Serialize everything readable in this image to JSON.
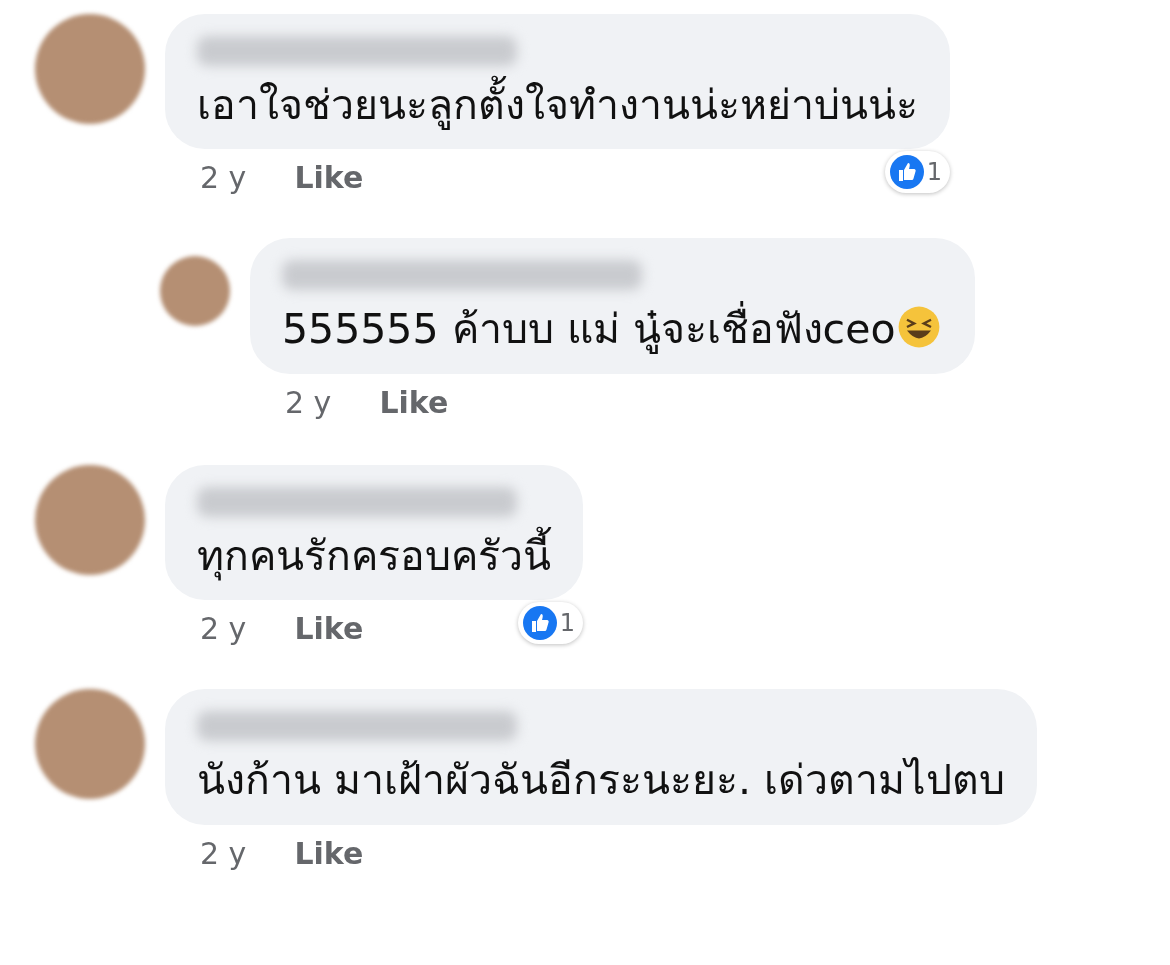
{
  "comments": [
    {
      "text": "เอาใจช่วยนะลูกตั้งใจทำงานน่ะหย่าบ่นน่ะ",
      "time": "2 y",
      "action": "Like",
      "reaction_count": "1",
      "replies": [
        {
          "text": "555555 ค้าบบ แม่ นู๋จะเชื่อฟังceo",
          "time": "2 y",
          "action": "Like",
          "trailing_emoji": true
        }
      ]
    },
    {
      "text": "ทุกคนรักครอบครัวนี้",
      "time": "2 y",
      "action": "Like",
      "reaction_count": "1"
    },
    {
      "text": "นังก้าน มาเฝ้าผัวฉันอีกระนะยะ. เด่วตามไปตบ",
      "time": "2 y",
      "action": "Like"
    }
  ]
}
